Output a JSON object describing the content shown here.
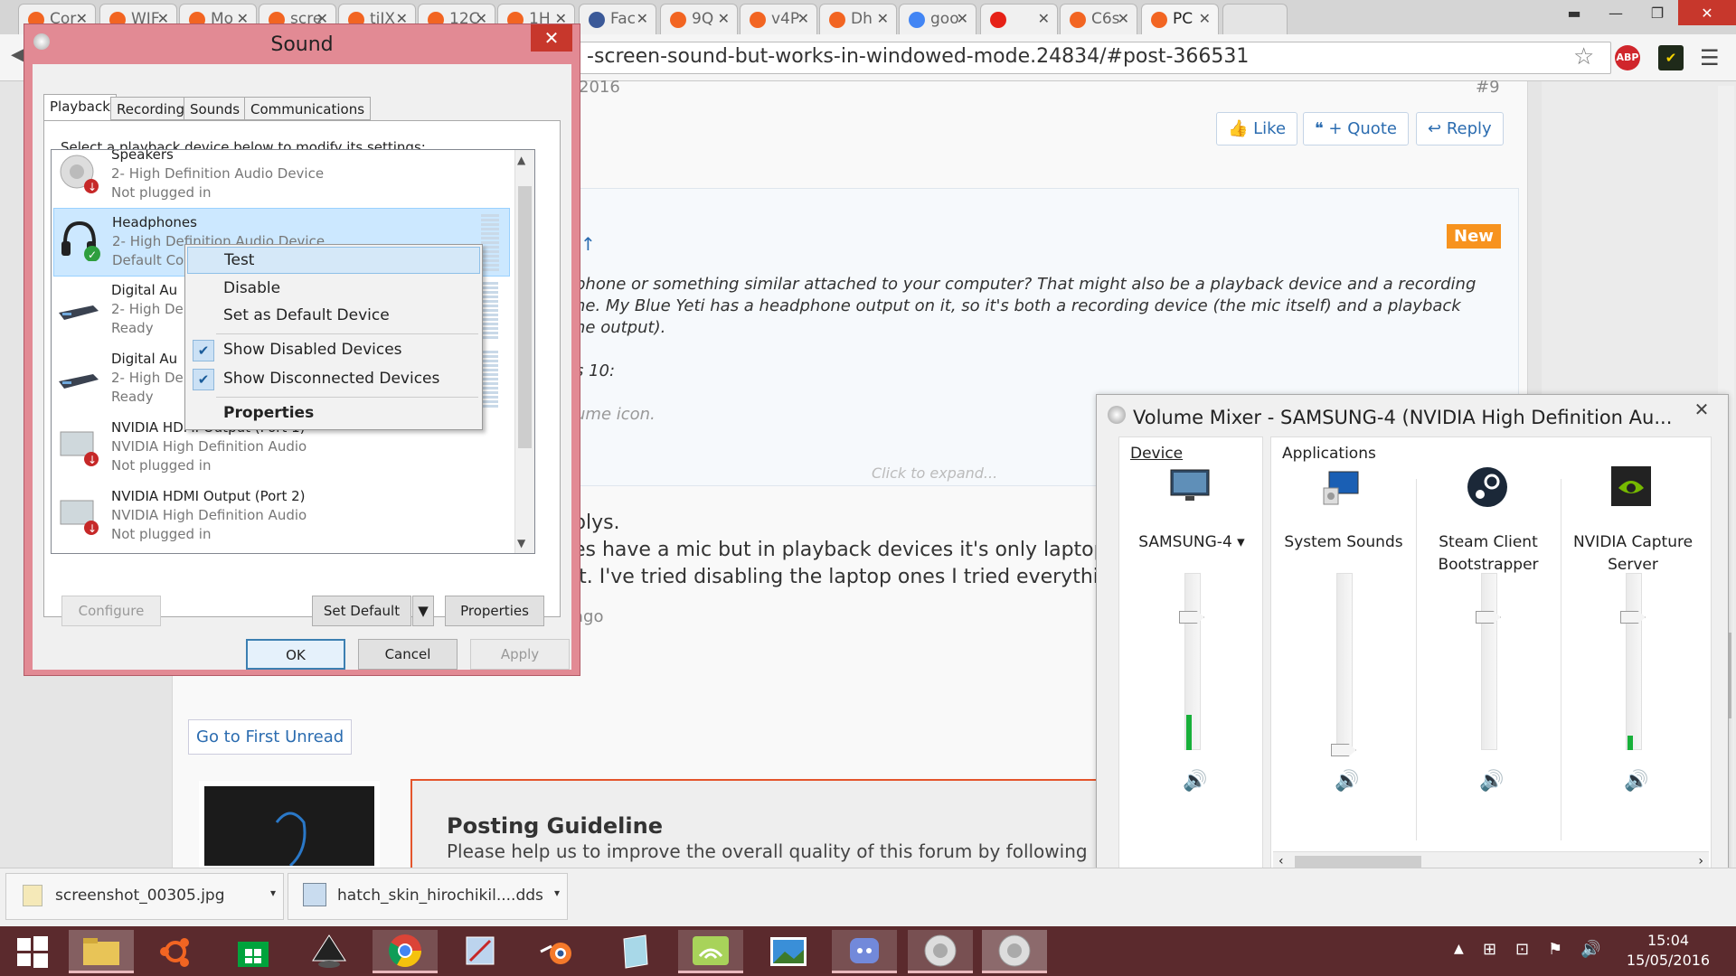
{
  "browser": {
    "tabs": [
      {
        "label": "Cor",
        "icon": "ubuntu-icon"
      },
      {
        "label": "WIF",
        "icon": "ubuntu-icon"
      },
      {
        "label": "Mo",
        "icon": "ubuntu-icon"
      },
      {
        "label": "scre",
        "icon": "ubuntu-icon"
      },
      {
        "label": "tiJX",
        "icon": "ubuntu-icon"
      },
      {
        "label": "12C",
        "icon": "ubuntu-icon"
      },
      {
        "label": "1H",
        "icon": "ubuntu-icon"
      },
      {
        "label": "Fac",
        "icon": "facebook-icon"
      },
      {
        "label": "9Q",
        "icon": "ubuntu-icon"
      },
      {
        "label": "v4P",
        "icon": "ubuntu-icon"
      },
      {
        "label": "Dh",
        "icon": "ubuntu-icon"
      },
      {
        "label": "goo",
        "icon": "google-icon"
      },
      {
        "label": "",
        "icon": "youtube-icon"
      },
      {
        "label": "C6s",
        "icon": "ubuntu-icon"
      },
      {
        "label": "PC",
        "icon": "ubuntu-icon"
      }
    ],
    "url": "-screen-sound-but-works-in-windowed-mode.24834/#post-366531",
    "extensions": [
      "star-icon",
      "adblock-plus-icon",
      "norton-icon",
      "menu-icon"
    ]
  },
  "forum": {
    "post_date": "2016",
    "post_num": "#9",
    "like": "Like",
    "quote": "+ Quote",
    "reply": "Reply",
    "new_badge": "New",
    "arrow": "↑",
    "quote_lines": [
      "phone or something similar attached to your computer? That might also be a playback device and a recording",
      "ne. My Blue Yeti has a headphone output on it, so it's both a recording device (the mic itself) and a playback",
      "ne output).",
      "s 10:",
      "ume icon."
    ],
    "click_expand": "Click to expand...",
    "reply_lines": [
      "plys.",
      "es have a mic but in playback devices it's only laptop spe",
      "lt. I've tried disabling the laptop ones I tried everything a"
    ],
    "ago": "ago",
    "first_unread": "Go to First Unread",
    "guideline_title": "Posting Guideline",
    "guideline_text": "Please help us to improve the overall quality of this forum by following these gu"
  },
  "sound": {
    "title": "Sound",
    "tabs": [
      "Playback",
      "Recording",
      "Sounds",
      "Communications"
    ],
    "instruction": "Select a playback device below to modify its settings:",
    "devices": [
      {
        "name": "Speakers",
        "line1": "2- High Definition Audio Device",
        "line2": "Not plugged in"
      },
      {
        "name": "Headphones",
        "line1": "2- High Definition Audio Device",
        "line2": "Default Co"
      },
      {
        "name": "Digital Au",
        "line1": "2- High De",
        "line2": "Ready"
      },
      {
        "name": "Digital Au",
        "line1": "2- High De",
        "line2": "Ready"
      },
      {
        "name": "NVIDIA HDMI Output (Port 1)",
        "line1": "NVIDIA High Definition Audio",
        "line2": "Not plugged in"
      },
      {
        "name": "NVIDIA HDMI Output (Port 2)",
        "line1": "NVIDIA High Definition Audio",
        "line2": "Not plugged in"
      }
    ],
    "configure": "Configure",
    "set_default": "Set Default",
    "properties": "Properties",
    "ok": "OK",
    "cancel": "Cancel",
    "apply": "Apply"
  },
  "context_menu": {
    "items": [
      "Test",
      "Disable",
      "Set as Default Device",
      "Show Disabled Devices",
      "Show Disconnected Devices",
      "Properties"
    ]
  },
  "mixer": {
    "title": "Volume Mixer - SAMSUNG-4 (NVIDIA High Definition Au...",
    "device_label": "Device",
    "apps_label": "Applications",
    "device_name": "SAMSUNG-4",
    "device_level": 0.2,
    "apps": [
      {
        "name": "System Sounds",
        "level": 0.0
      },
      {
        "name": "Steam Client Bootstrapper",
        "level": 0.0
      },
      {
        "name": "NVIDIA Capture Server",
        "level": 0.08
      }
    ]
  },
  "downloads": [
    {
      "name": "screenshot_00305.jpg"
    },
    {
      "name": "hatch_skin_hirochikil....dds"
    }
  ],
  "taskbar": {
    "time": "15:04",
    "date": "15/05/2016"
  },
  "colors": {
    "taskbar": "#5b2a2d",
    "sound_frame": "#e28a94",
    "accent": "#1e6cc7",
    "new_badge": "#f7931e"
  }
}
